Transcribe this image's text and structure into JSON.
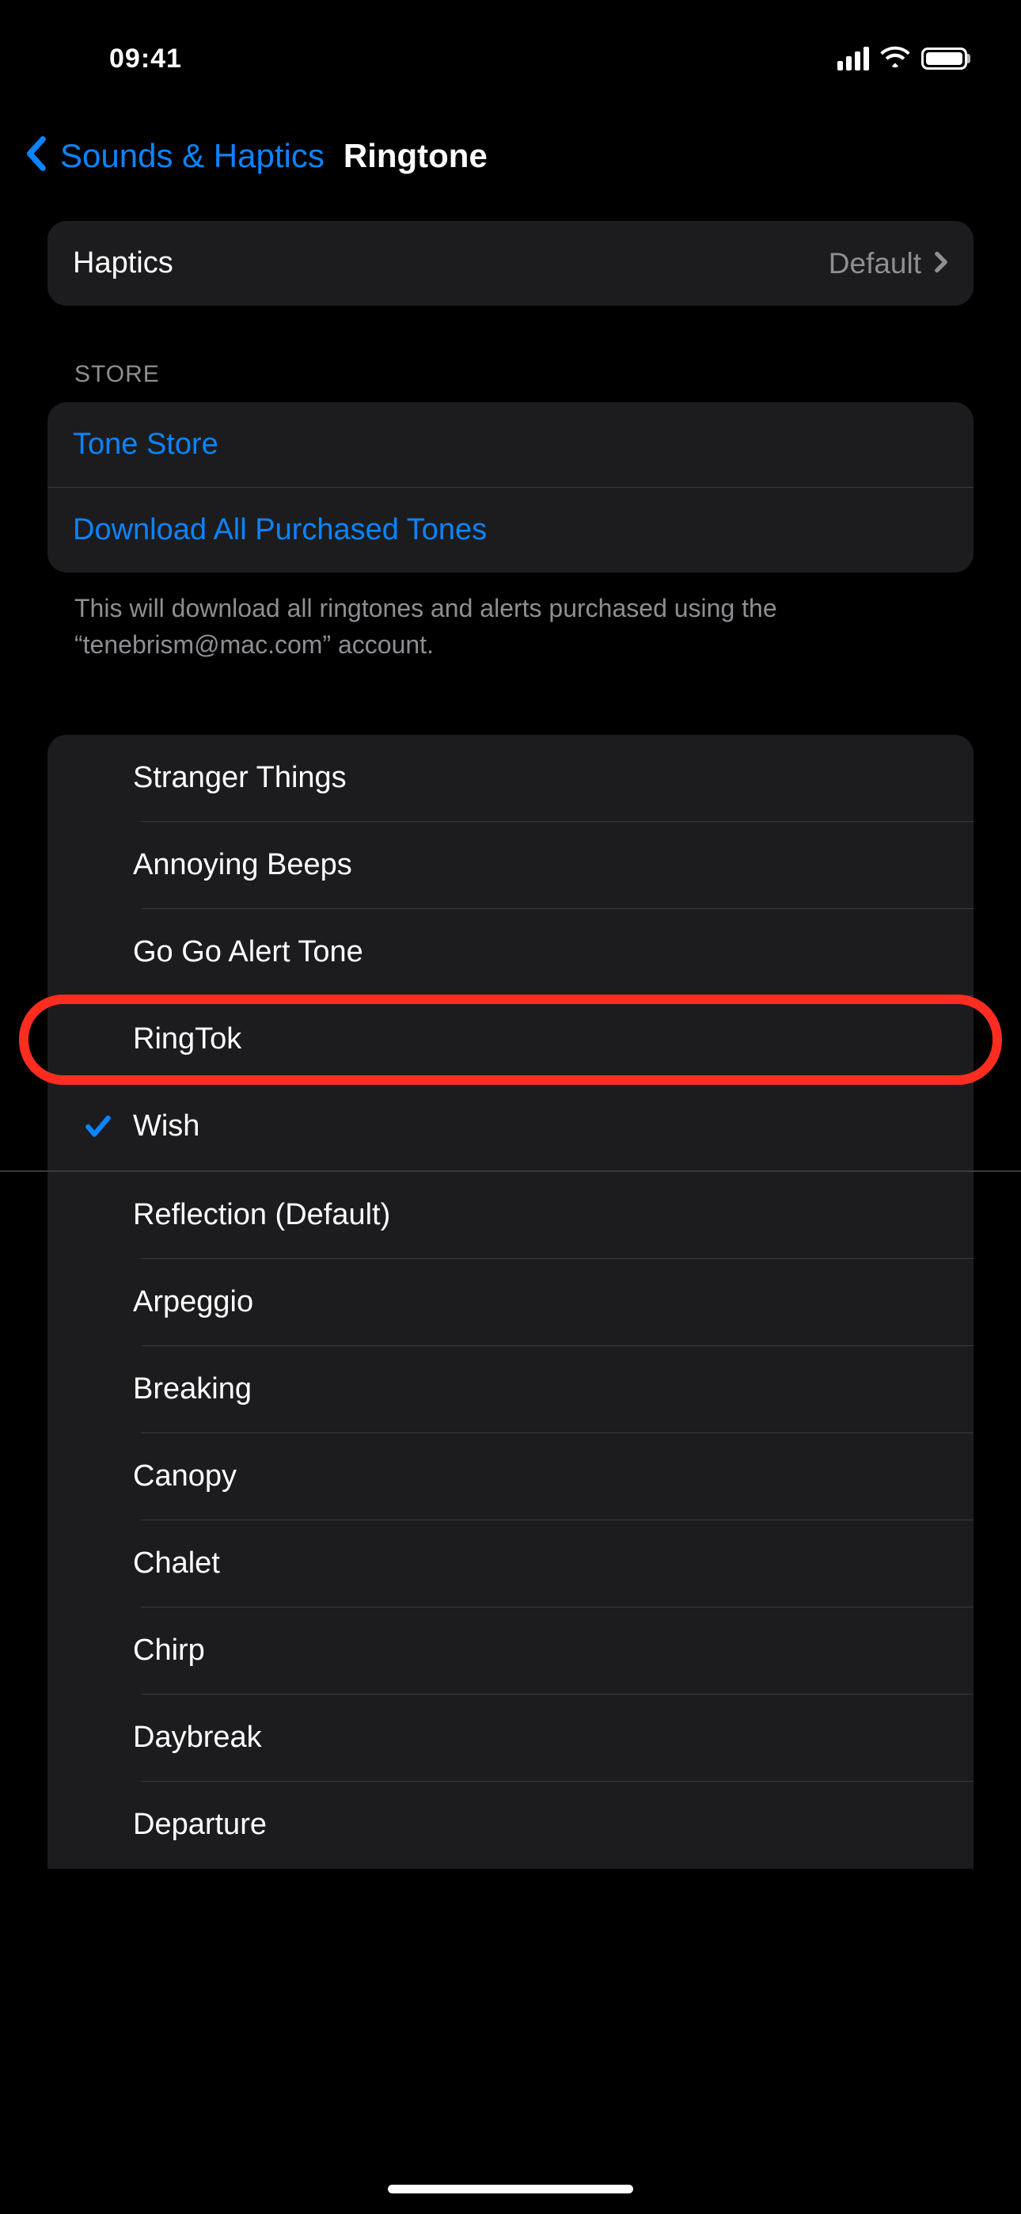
{
  "status": {
    "time": "09:41"
  },
  "nav": {
    "back_label": "Sounds & Haptics",
    "title": "Ringtone"
  },
  "haptics": {
    "label": "Haptics",
    "value": "Default"
  },
  "store": {
    "header": "STORE",
    "tone_store": "Tone Store",
    "download_all": "Download All Purchased Tones",
    "footer": "This will download all ringtones and alerts purchased using the “tenebrism@mac.com” account."
  },
  "ringtones": {
    "custom": [
      {
        "name": "Stranger Things",
        "selected": false,
        "highlighted": false
      },
      {
        "name": "Annoying Beeps",
        "selected": false,
        "highlighted": false
      },
      {
        "name": "Go Go Alert Tone",
        "selected": false,
        "highlighted": false
      },
      {
        "name": "RingTok",
        "selected": false,
        "highlighted": true
      },
      {
        "name": "Wish",
        "selected": true,
        "highlighted": false
      }
    ],
    "builtin": [
      {
        "name": "Reflection (Default)"
      },
      {
        "name": "Arpeggio"
      },
      {
        "name": "Breaking"
      },
      {
        "name": "Canopy"
      },
      {
        "name": "Chalet"
      },
      {
        "name": "Chirp"
      },
      {
        "name": "Daybreak"
      },
      {
        "name": "Departure"
      }
    ]
  }
}
